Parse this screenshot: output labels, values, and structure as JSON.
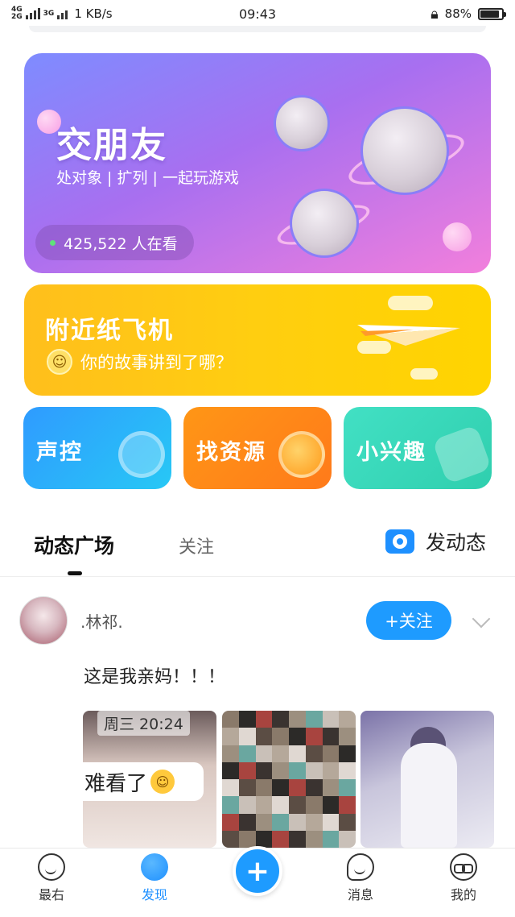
{
  "status_bar": {
    "network_top": "4G",
    "network_bottom": "2G",
    "network_right": "3G",
    "speed": "1 KB/s",
    "time": "09:43",
    "battery": "88%",
    "battery_level": 0.88
  },
  "friends_card": {
    "title": "交朋友",
    "subtitle": "处对象 | 扩列 | 一起玩游戏",
    "live_count": "425,522 人在看"
  },
  "plane_card": {
    "title": "附近纸飞机",
    "subtitle": "你的故事讲到了哪？"
  },
  "features": [
    {
      "label": "声控"
    },
    {
      "label": "找资源"
    },
    {
      "label": "小兴趣"
    }
  ],
  "tabs": {
    "main": "动态广场",
    "follow": "关注",
    "post_button": "发动态"
  },
  "post": {
    "username": ".林祁.",
    "follow_button": "+关注",
    "text": "这是我亲妈！！！",
    "photo1_timestamp": "周三 20:24",
    "photo1_caption": "难看了"
  },
  "bottom_nav": [
    {
      "label": "最右",
      "icon": "smiley-icon",
      "active": false
    },
    {
      "label": "发现",
      "icon": "planet-icon",
      "active": true
    },
    {
      "label": "消息",
      "icon": "chat-icon",
      "active": false
    },
    {
      "label": "我的",
      "icon": "glasses-icon",
      "active": false
    }
  ],
  "fab_label": "+",
  "colors": {
    "accent": "#1e9bff",
    "friends_card": "#a86ff0",
    "plane_card": "#ffc91a",
    "feature_voice": "#2f9bff",
    "feature_resource": "#ff8c18",
    "feature_interest": "#3dd9bb"
  }
}
